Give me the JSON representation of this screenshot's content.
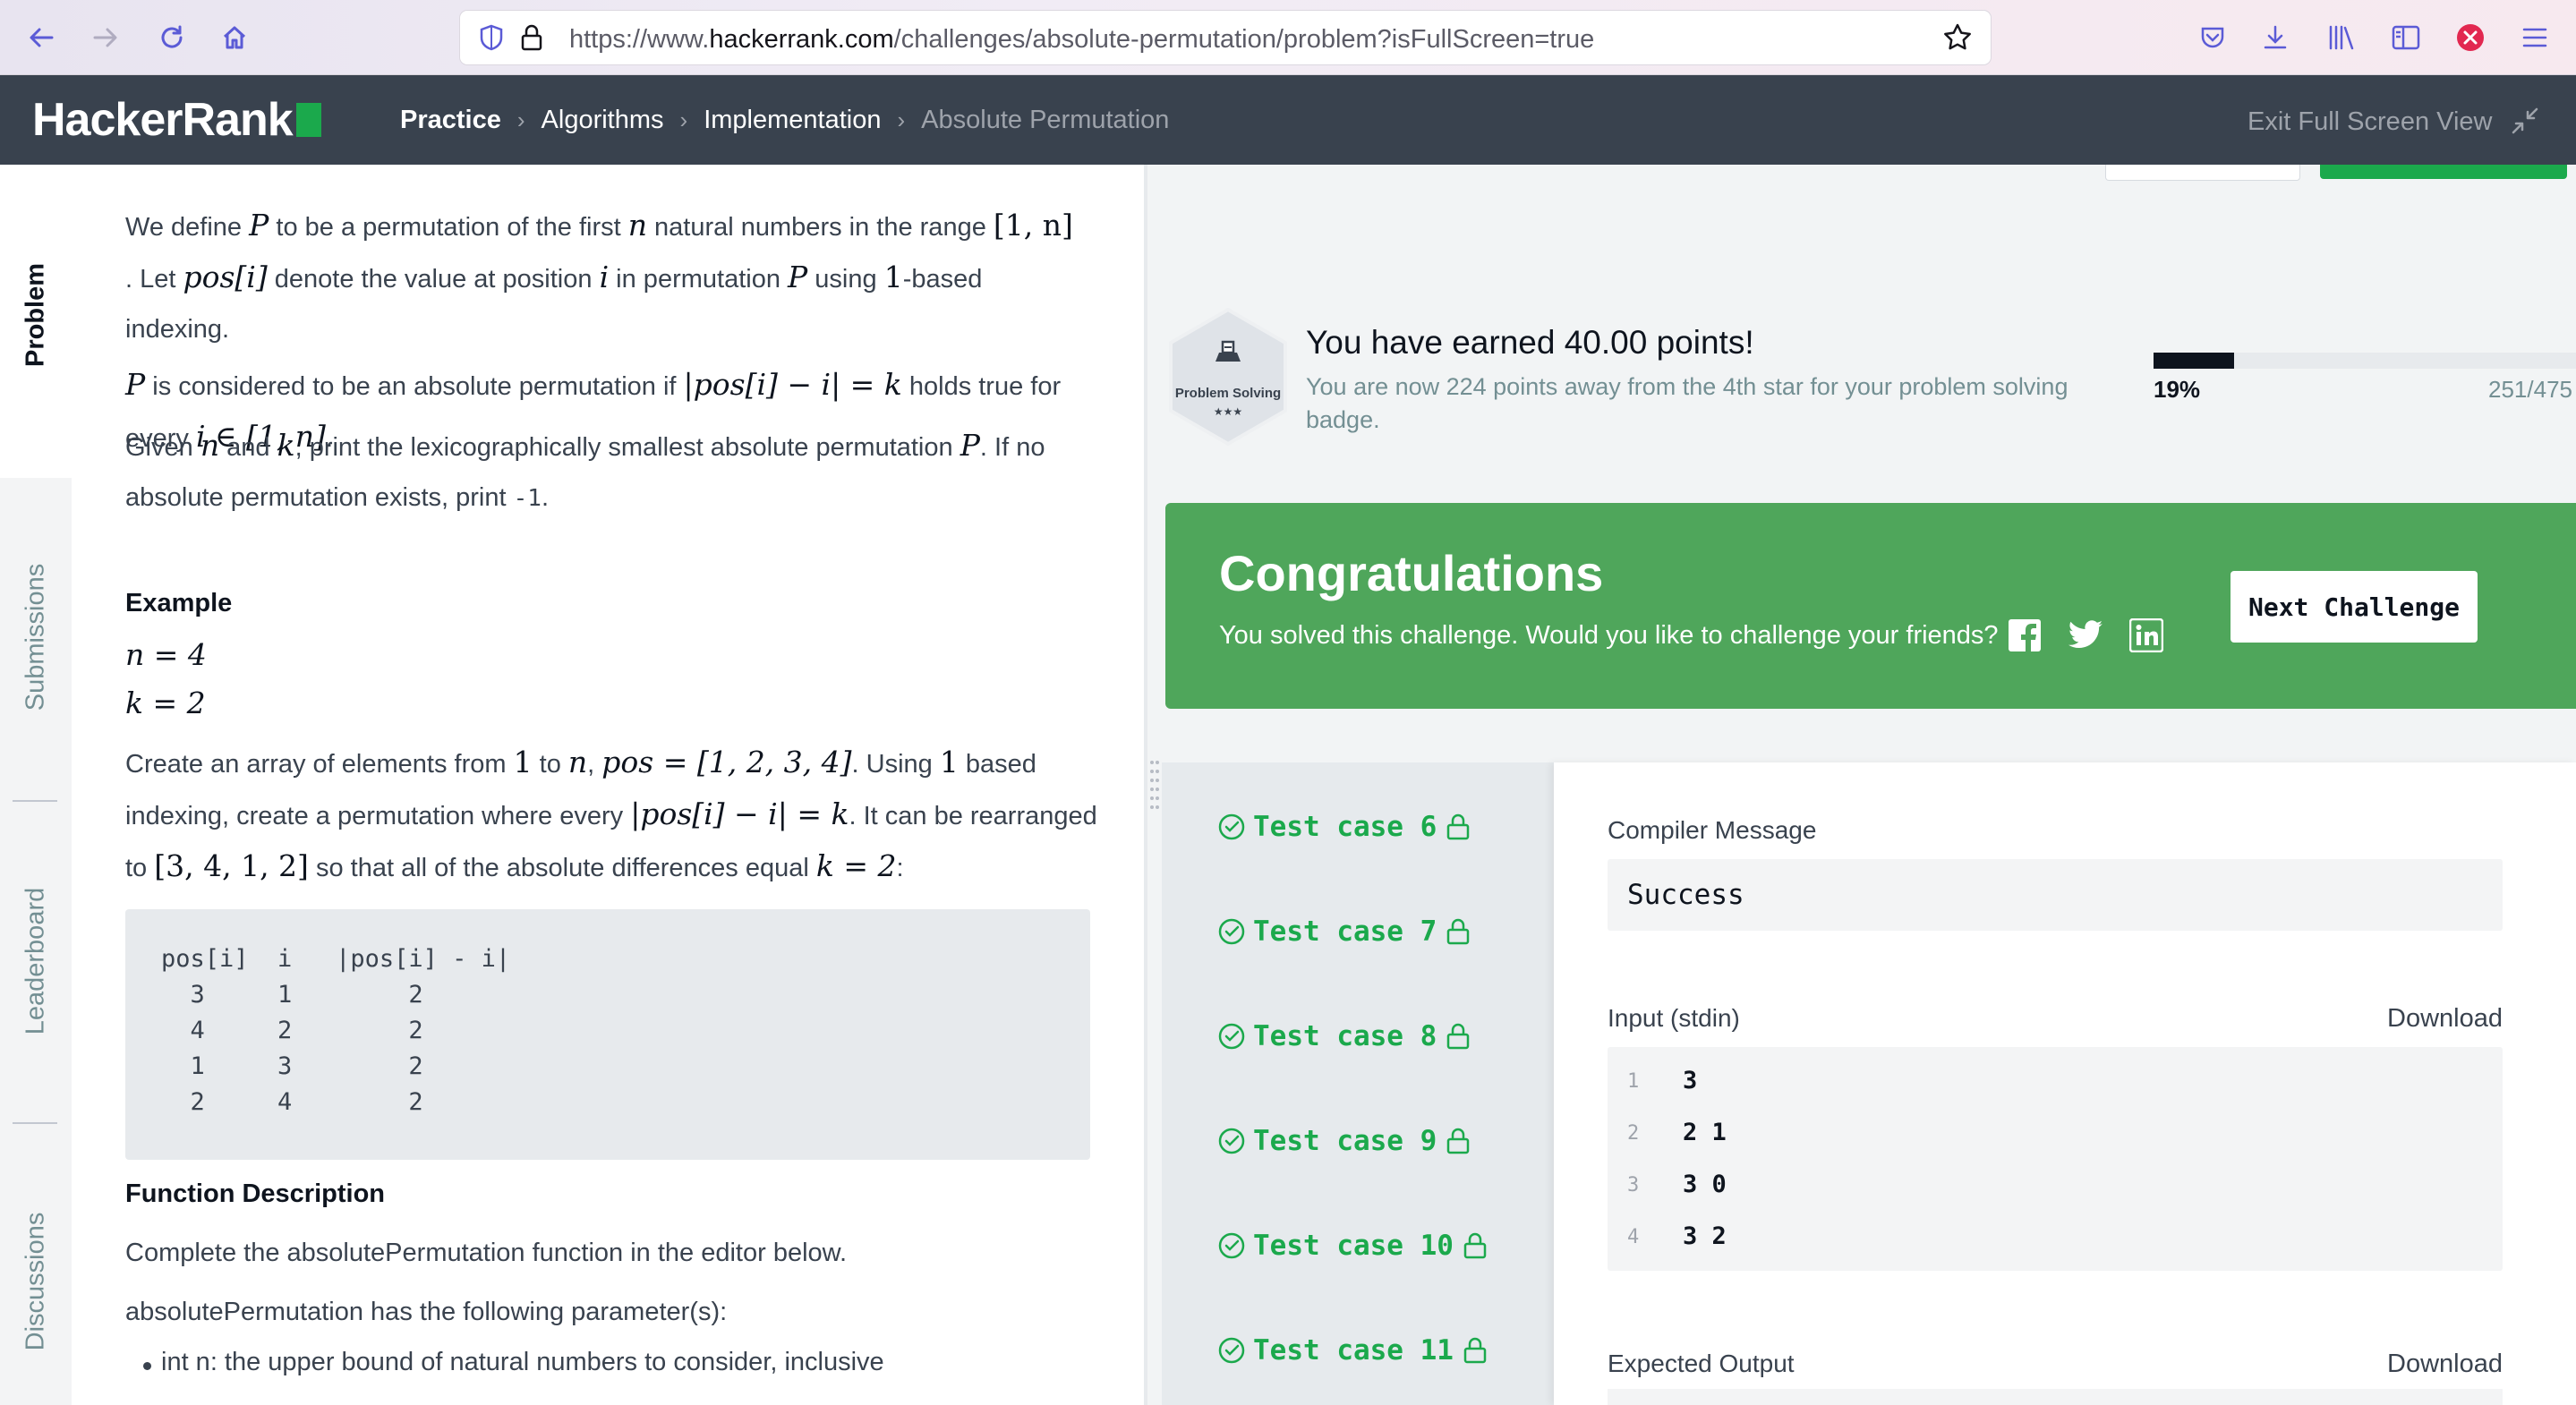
{
  "browser": {
    "url_prefix": "https://www.",
    "url_domain": "hackerrank.com",
    "url_path": "/challenges/absolute-permutation/problem?isFullScreen=true",
    "icons": [
      "back-icon",
      "forward-icon",
      "reload-icon",
      "home-icon",
      "shield-icon",
      "lock-icon",
      "star-icon",
      "pocket-icon",
      "download-icon",
      "library-icon",
      "sidebar-icon",
      "close-circle-icon",
      "menu-icon"
    ]
  },
  "header": {
    "logo": "HackerRank",
    "breadcrumb": [
      "Practice",
      "Algorithms",
      "Implementation",
      "Absolute Permutation"
    ],
    "exit_full_screen": "Exit Full Screen View"
  },
  "tabs": [
    "Problem",
    "Submissions",
    "Leaderboard",
    "Discussions"
  ],
  "problem": {
    "p1": {
      "t1": "We define ",
      "P": "P",
      "t2": " to be a permutation of the first ",
      "n": "n",
      "t3": " natural numbers in the range ",
      "range": "[1, n]",
      "t4": ". Let ",
      "posi": "pos[i]",
      "t5": " denote the value at position ",
      "i": "i",
      "t6": " in permutation ",
      "P2": "P",
      "t7": " using ",
      "one": "1",
      "t8": "-based",
      "t9": "indexing."
    },
    "p2": {
      "P": "P",
      "t1": " is considered to be an absolute permutation if ",
      "cond": "|pos[i] − i| = k",
      "t2": " holds true for",
      "t3": "every ",
      "cond2": "i ∈ [1, n]",
      "t4": "."
    },
    "p3": {
      "t1": "Given ",
      "n": "n",
      "t2": " and ",
      "k": "k",
      "t3": ", print the lexicographically smallest absolute permutation ",
      "P": "P",
      "t4": ". If no",
      "t5": "absolute permutation exists, print ",
      "neg": "-1",
      "t6": "."
    },
    "example_heading": "Example",
    "ex_n": "n = 4",
    "ex_k": "k = 2",
    "p4": {
      "t1": "Create an array of elements from ",
      "one": "1",
      "t2": " to ",
      "n": "n",
      "t3": ", ",
      "pos": "pos = [1, 2, 3, 4]",
      "t4": ". Using ",
      "one2": "1",
      "t5": " based",
      "t6": "indexing, create a permutation where every ",
      "cond": "|pos[i] − i| = k",
      "t7": ". It can be rearranged",
      "t8": "to ",
      "arr": "[3, 4, 1, 2]",
      "t9": " so that all of the absolute differences equal ",
      "keq": "k = 2",
      "t10": ":"
    },
    "code_lines": [
      "pos[i]  i   |pos[i] - i|",
      "  3     1        2",
      "  4     2        2",
      "  1     3        2",
      "  2     4        2"
    ],
    "function_heading": "Function Description",
    "fd_text": "Complete the absolutePermutation function in the editor below.",
    "params_text": "absolutePermutation has the following parameter(s):",
    "bullet1": "int n: the upper bound of natural numbers to consider, inclusive"
  },
  "result": {
    "badge_label": "Problem Solving",
    "badge_stars": "★★★",
    "earned_title": "You have earned 40.00 points!",
    "earned_sub": "You are now 224 points away from the 4th star for your problem solving badge.",
    "progress_fraction": 0.19,
    "progress_pct": "19%",
    "progress_count": "251/475",
    "congrats_title": "Congratulations",
    "congrats_sub": "You solved this challenge. Would you like to challenge your friends?",
    "next_challenge": "Next Challenge",
    "accent": "#1ba94c",
    "banner_color": "#4fa65b"
  },
  "test_cases": [
    "Test case 6",
    "Test case 7",
    "Test case 8",
    "Test case 9",
    "Test case 10",
    "Test case 11"
  ],
  "detail": {
    "compiler_label": "Compiler Message",
    "compiler_msg": "Success",
    "input_label": "Input (stdin)",
    "download": "Download",
    "input_lines": [
      {
        "no": "1",
        "val": "3"
      },
      {
        "no": "2",
        "val": "2 1"
      },
      {
        "no": "3",
        "val": "3 0"
      },
      {
        "no": "4",
        "val": "3 2"
      }
    ],
    "expected_label": "Expected Output"
  }
}
